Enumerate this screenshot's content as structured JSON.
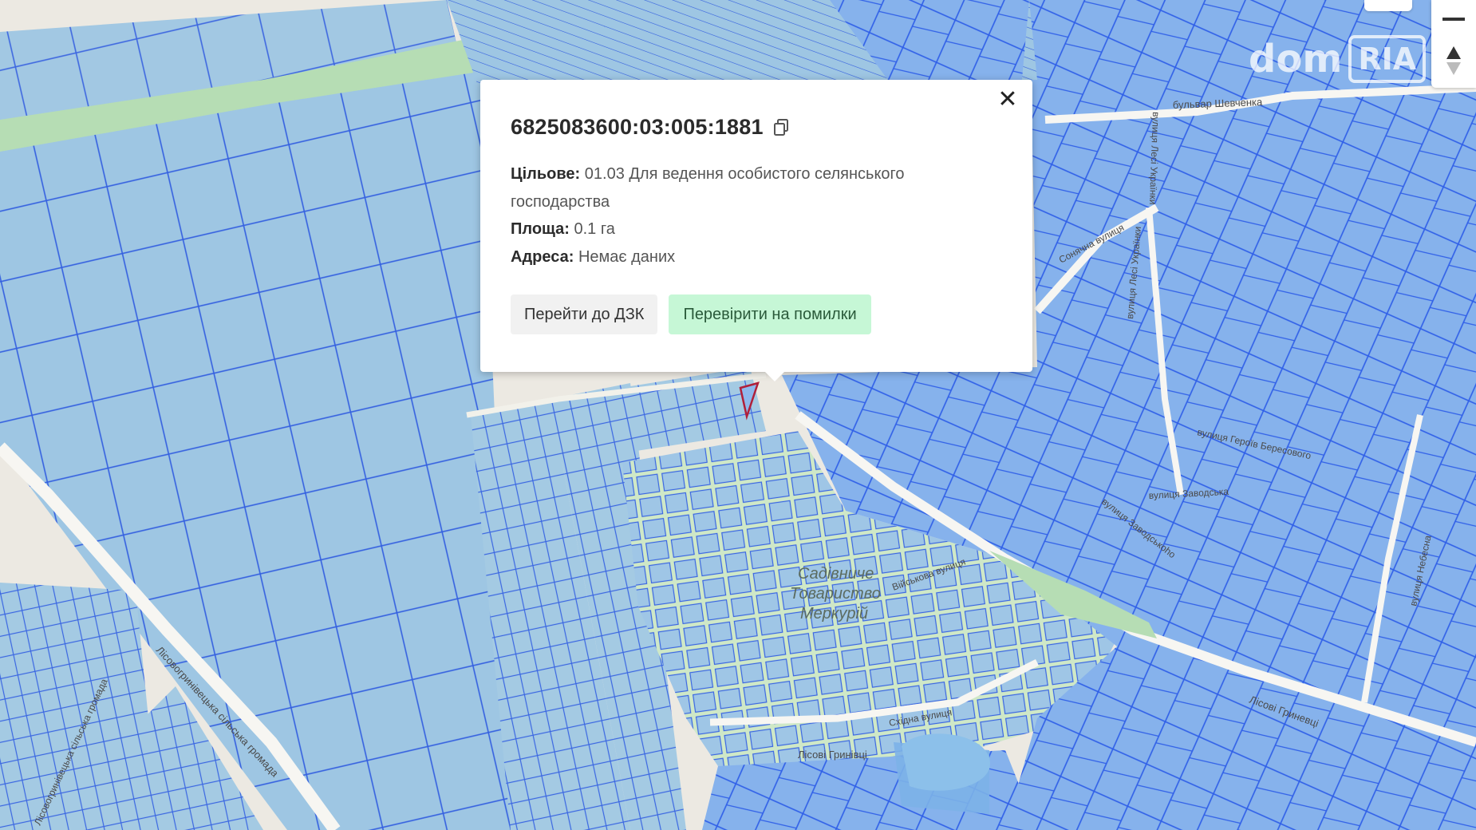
{
  "parcel": {
    "cadastral_number": "6825083600:03:005:1881",
    "purpose_label": "Цільове:",
    "purpose_value": "01.03 Для ведення особистого селянського господарства",
    "area_label": "Площа:",
    "area_value": "0.1 га",
    "address_label": "Адреса:",
    "address_value": "Немає даних"
  },
  "buttons": {
    "goto_dzk": "Перейти до ДЗК",
    "check_errors": "Перевірити на помилки"
  },
  "map_labels": {
    "garden_area": [
      "Садівниче",
      "Товариство",
      "Меркурій"
    ],
    "streets": {
      "shevchenka_blvd": "бульвар Шевченка",
      "lesi_ukrainky_1": "вулиця Лесі Українки",
      "lesi_ukrainky_2": "вулиця Лесі Українки",
      "sonyachna": "Сонячна вулиця",
      "beresovoho": "вулиця Героїв Бересового",
      "zavodska": "вулиця Заводська",
      "zavodskyi": "вулиця Заводськоho",
      "viiskova": "Військова вулиця",
      "skhidna": "Східна вулиця",
      "lisovi_hrynivtsi": "Лісові Гринівці",
      "lisovi_hrynivtsi_2": "Лісові Гриневці",
      "nebesna": "вулиця Небесна",
      "lisovohrynivetska": "Лісовогринівецька сільська громада",
      "lisovohrynivetska_2": "Лісовогринівецька сільська громада"
    }
  },
  "watermark": {
    "text": "dom",
    "badge": "RIA"
  },
  "icons": {
    "close": "close-icon",
    "copy": "copy-icon",
    "zoom_out": "zoom-out-icon",
    "compass": "compass-icon"
  },
  "colors": {
    "parcel_fill": "#9cc3ea",
    "parcel_stroke": "#2f5fe8",
    "dense_fill": "#86b1ec",
    "green_area": "#cbe8c0",
    "selected_parcel": "#b0203a",
    "button_green": "#c6f7d6"
  }
}
